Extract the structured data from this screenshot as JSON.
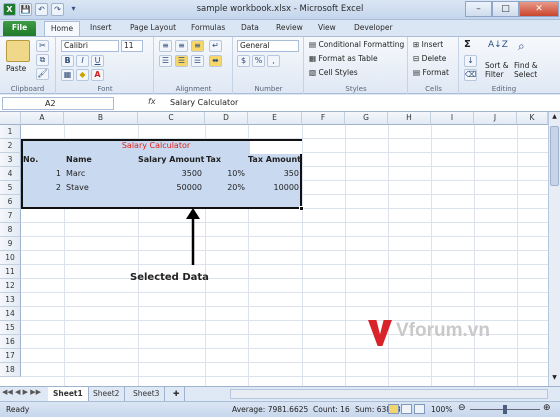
{
  "window": {
    "title": "sample workbook.xlsx - Microsoft Excel",
    "controls": [
      "–",
      "□",
      "✕"
    ]
  },
  "quick_access": [
    "X",
    "💾",
    "↶",
    "↷",
    "▾"
  ],
  "tabs": [
    "File",
    "Home",
    "Insert",
    "Page Layout",
    "Formulas",
    "Data",
    "Review",
    "View",
    "Developer"
  ],
  "ribbon": {
    "clipboard": {
      "paste": "Paste",
      "label": "Clipboard"
    },
    "font": {
      "name": "Calibri",
      "size": "11",
      "label": "Font",
      "bold": "B",
      "italic": "I",
      "underline": "U"
    },
    "alignment": {
      "label": "Alignment"
    },
    "number": {
      "format": "General",
      "currency": "$",
      "percent": "%",
      "comma": ",",
      "label": "Number"
    },
    "styles": {
      "conditional": "Conditional Formatting",
      "table": "Format as Table",
      "cell": "Cell Styles",
      "label": "Styles"
    },
    "cells": {
      "insert": "Insert",
      "delete": "Delete",
      "format": "Format",
      "label": "Cells"
    },
    "editing": {
      "sigma": "Σ",
      "sort": "Sort &",
      "filter": "Filter",
      "find": "Find &",
      "select": "Select",
      "label": "Editing"
    }
  },
  "formula_bar": {
    "name_box": "A2",
    "fx": "fx",
    "content": "Salary Calculator"
  },
  "columns": [
    "A",
    "B",
    "C",
    "D",
    "E",
    "F",
    "G",
    "H",
    "I",
    "J",
    "K"
  ],
  "rows": [
    "1",
    "2",
    "3",
    "4",
    "5",
    "6",
    "7",
    "8",
    "9",
    "10",
    "11",
    "12",
    "13",
    "14",
    "15",
    "16",
    "17",
    "18"
  ],
  "sheet": {
    "title": "Salary Calculator",
    "headers": [
      "No.",
      "Name",
      "Salary Amount",
      "Tax",
      "Tax Amount"
    ],
    "data": [
      [
        "1",
        "Marc",
        "3500",
        "10%",
        "350"
      ],
      [
        "2",
        "Stave",
        "50000",
        "20%",
        "10000"
      ]
    ]
  },
  "annotation": {
    "label": "Selected Data"
  },
  "watermark": {
    "text": "Vforum.vn"
  },
  "sheet_tabs": [
    "Sheet1",
    "Sheet2",
    "Sheet3"
  ],
  "status": {
    "mode": "Ready",
    "average": "Average: 7981.6625",
    "count": "Count: 16",
    "sum": "Sum: 63853.3",
    "zoom": "100%"
  },
  "colors": {
    "title_red": "#e0201a",
    "selection": "#c9daf0",
    "file_tab": "#2a8a34"
  }
}
